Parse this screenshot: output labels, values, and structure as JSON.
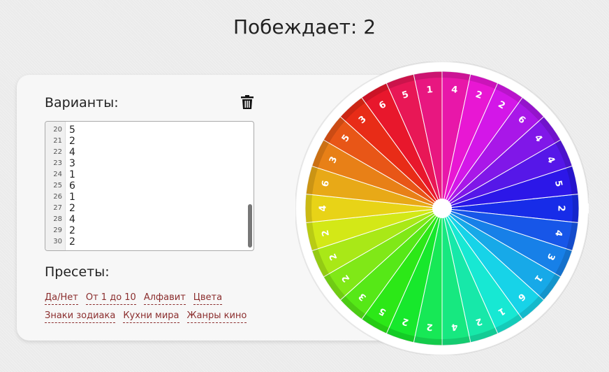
{
  "header": {
    "winner_text": "Побеждает: 2"
  },
  "options_panel": {
    "title": "Варианты:",
    "trash_icon": "trash-icon",
    "lines": [
      {
        "num": "20",
        "value": "5"
      },
      {
        "num": "21",
        "value": "2"
      },
      {
        "num": "22",
        "value": "4"
      },
      {
        "num": "23",
        "value": "3"
      },
      {
        "num": "24",
        "value": "1"
      },
      {
        "num": "25",
        "value": "6"
      },
      {
        "num": "26",
        "value": "1"
      },
      {
        "num": "27",
        "value": "2"
      },
      {
        "num": "28",
        "value": "4"
      },
      {
        "num": "29",
        "value": "2"
      },
      {
        "num": "30",
        "value": "2"
      }
    ]
  },
  "presets": {
    "title": "Пресеты:",
    "items": [
      "Да/Нет",
      "От 1 до 10",
      "Алфавит",
      "Цвета",
      "Знаки зодиака",
      "Кухни мира",
      "Жанры кино"
    ]
  },
  "wheel": {
    "labels": [
      "2",
      "4",
      "3",
      "1",
      "6",
      "1",
      "2",
      "4",
      "2",
      "2",
      "5",
      "3",
      "2",
      "2",
      "2",
      "4",
      "6",
      "3",
      "5",
      "3",
      "6",
      "5",
      "1",
      "4",
      "2",
      "2",
      "6",
      "4",
      "4",
      "5"
    ]
  }
}
